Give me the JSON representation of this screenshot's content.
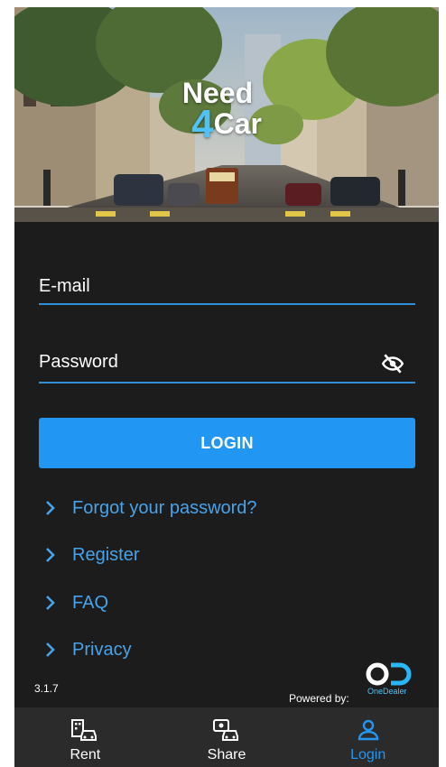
{
  "app": {
    "logo_line1": "Need",
    "logo_four": "4",
    "logo_line2": "Car"
  },
  "form": {
    "email_placeholder": "E-mail",
    "password_placeholder": "Password",
    "login_label": "LOGIN"
  },
  "links": {
    "forgot": "Forgot your password?",
    "register": "Register",
    "faq": "FAQ",
    "privacy": "Privacy"
  },
  "footer": {
    "version": "3.1.7",
    "powered_by": "Powered by:",
    "partner_name": "OneDealer"
  },
  "nav": {
    "rent": "Rent",
    "share": "Share",
    "login": "Login"
  },
  "colors": {
    "accent": "#2196f3",
    "link": "#47a3ea",
    "background": "#1c1c1c",
    "nav_background": "#2b2b2b"
  }
}
